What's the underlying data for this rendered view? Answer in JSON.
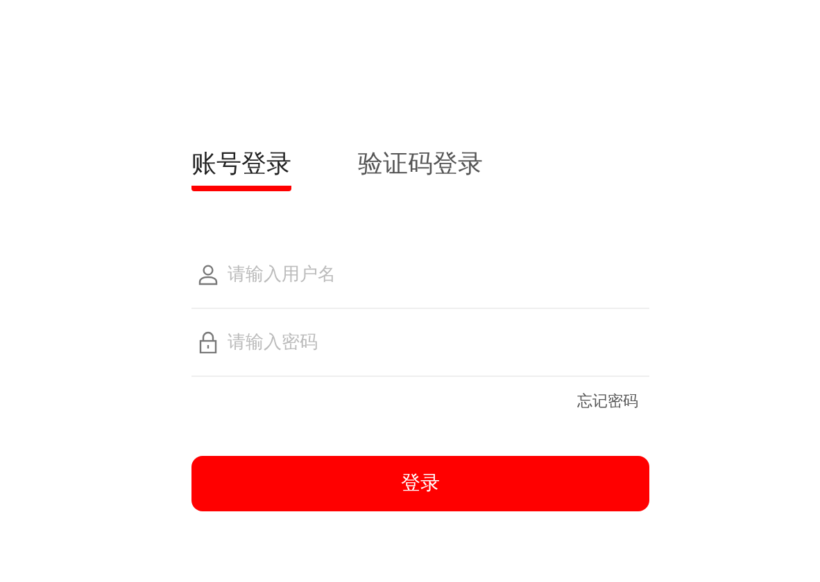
{
  "tabs": [
    {
      "label": "账号登录",
      "selected": true
    },
    {
      "label": "验证码登录",
      "selected": false
    }
  ],
  "fields": [
    {
      "kind": "user",
      "placeholder": "请输入用户名"
    },
    {
      "kind": "password",
      "placeholder": "请输入密码"
    }
  ],
  "forgot_link": "忘记密码",
  "submit_button": "登录"
}
